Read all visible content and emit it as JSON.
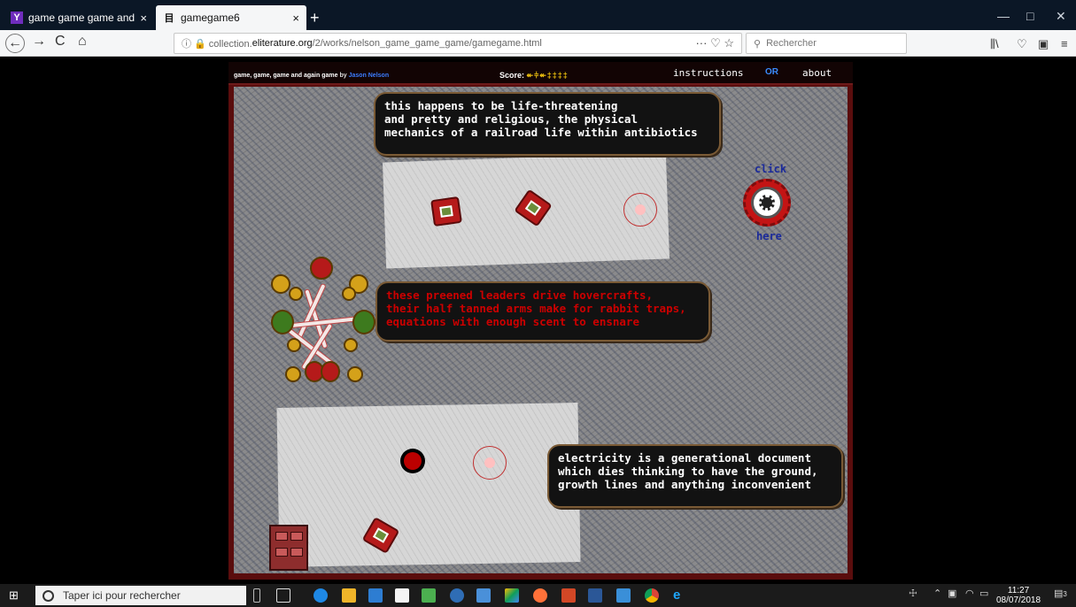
{
  "browser": {
    "tabs": [
      {
        "label": "game game game and again ga",
        "icon": "yc-icon",
        "icon_glyph": "Y",
        "close": "×"
      },
      {
        "label": "gamegame6",
        "icon": "page-icon",
        "icon_glyph": "目",
        "close": "×"
      }
    ],
    "new_tab": "+",
    "window_controls": [
      "—",
      "□",
      "✕"
    ],
    "nav": {
      "back": "←",
      "forward": "→",
      "reload": "C",
      "home": "⌂"
    },
    "url": {
      "prefix": "ⓘ 🔒 collection.",
      "host": "eliterature.org",
      "path": "/2/works/nelson_game_game_game/gamegame.html",
      "actions": "··· ♡ ☆"
    },
    "search_placeholder": "Rechercher",
    "toolbar_right": [
      "⫼\\",
      "♡",
      "▣",
      "≡"
    ]
  },
  "game": {
    "title": "game, game, game and again game",
    "by": "by",
    "author": "Jason Nelson",
    "score_label": "Score:",
    "score_value": "↞⫩↞‡‡‡‡",
    "instructions": "instructions",
    "or": "OR",
    "about": "about",
    "texts": [
      {
        "lines": [
          "this happens to be life-threatening",
          "and pretty and religious, the physical",
          "mechanics of a railroad life within antibiotics"
        ]
      },
      {
        "lines": [
          "these preened leaders drive hovercrafts,",
          "their half tanned arms make for rabbit traps,",
          "equations with enough scent to ensnare"
        ]
      },
      {
        "lines": [
          "electricity is a generational document",
          "which dies thinking to have the ground,",
          "growth lines and anything inconvenient"
        ]
      }
    ],
    "click_top": "click",
    "click_bottom": "here",
    "colors": {
      "frame": "#5a0d0d",
      "text_red": "#c00",
      "click_blue": "#1b2a9a",
      "wheel_red": "#c31414"
    }
  },
  "taskbar": {
    "search_placeholder": "Taper ici pour rechercher",
    "time": "11:27",
    "date": "08/07/2018",
    "notification_count": "3",
    "apps": [
      "cortana-mic-icon",
      "task-view-icon",
      "edge-icon",
      "file-explorer-icon",
      "photos-icon",
      "store-icon",
      "app-green-icon",
      "app-blue-icon",
      "app-window-icon",
      "drive-icon",
      "firefox-icon",
      "powerpoint-icon",
      "word-icon",
      "camera-icon",
      "chrome-icon",
      "ie-icon"
    ]
  }
}
